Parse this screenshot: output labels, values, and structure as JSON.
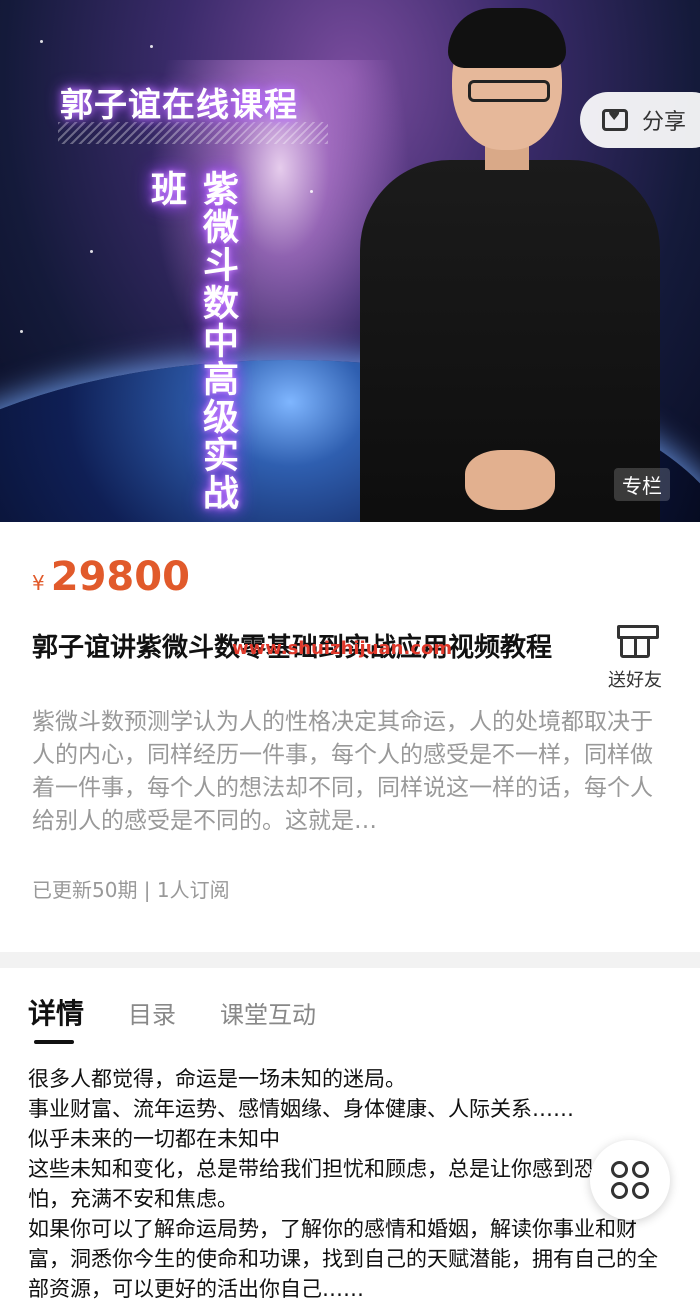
{
  "hero": {
    "course_tag": "郭子谊在线课程",
    "vertical_title": "紫微斗数中高级实战班",
    "share_label": "分享",
    "column_tag": "专栏"
  },
  "product": {
    "currency": "¥",
    "price": "29800",
    "title": "郭子谊讲紫微斗数零基础到实战应用视频教程",
    "watermark": "www.shuizhijuan.com",
    "gift_label": "送好友",
    "description": "紫微斗数预测学认为人的性格决定其命运，人的处境都取决于人的内心，同样经历一件事，每个人的感受是不一样，同样做着一件事，每个人的想法却不同，同样说这一样的话，每个人给别人的感受是不同的。这就是…",
    "meta": "已更新50期 | 1人订阅"
  },
  "tabs": [
    {
      "label": "详情"
    },
    {
      "label": "目录"
    },
    {
      "label": "课堂互动"
    }
  ],
  "article": {
    "lines": [
      "很多人都觉得，命运是一场未知的迷局。",
      "事业财富、流年运势、感情姻缘、身体健康、人际关系……",
      "似乎未来的一切都在未知中",
      "这些未知和变化，总是带给我们担忧和顾虑，总是让你感到恐惧和害怕，充满不安和焦虑。",
      "如果你可以了解命运局势，了解你的感情和婚姻，解读你事业和财富，洞悉你今生的使命和功课，找到自己的天赋潜能，拥有自己的全部资源，可以更好的活出你自己……"
    ]
  },
  "colors": {
    "price": "#e15a2b",
    "watermark": "#e0392b"
  },
  "icons": {
    "share": "share-icon",
    "gift": "gift-icon",
    "float": "grid-menu-icon"
  }
}
